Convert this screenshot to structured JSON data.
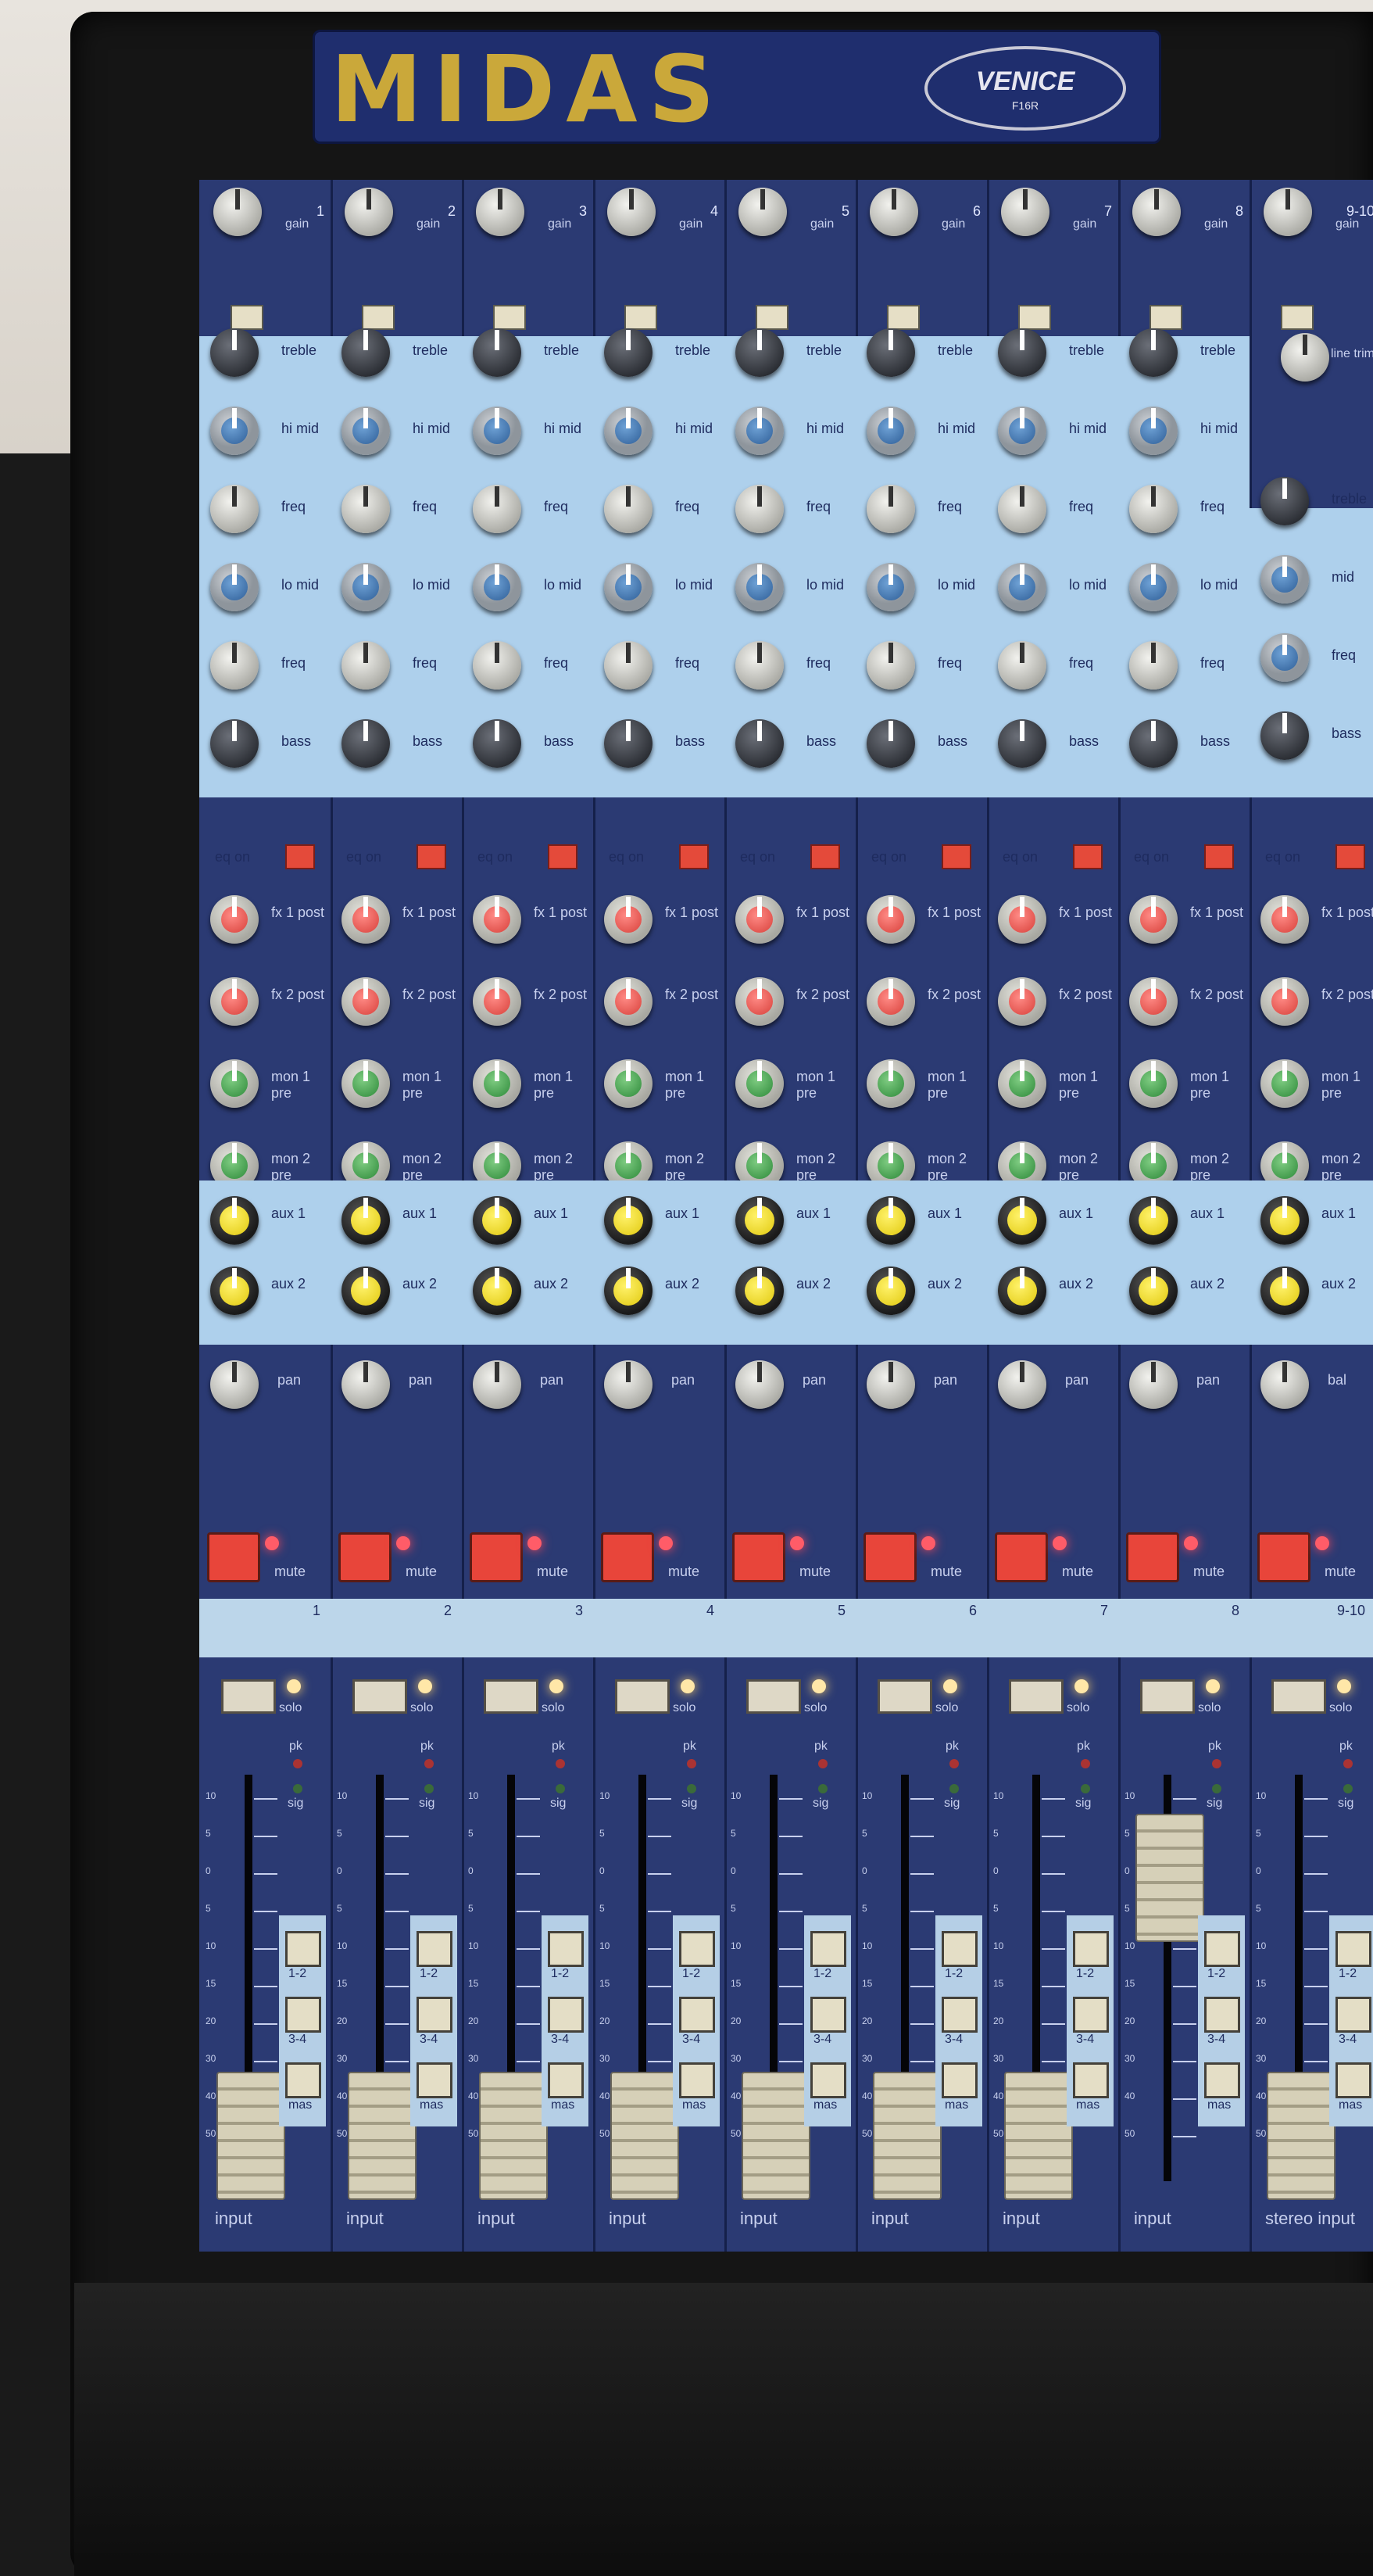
{
  "brand": {
    "logo": "MIDAS",
    "model": "VENICE",
    "model_sub": "F16R"
  },
  "strip_labels": {
    "gain": "gain",
    "line_trim": "line trim",
    "treble": "treble",
    "hi_mid": "hi mid",
    "freq": "freq",
    "lo_mid": "lo mid",
    "mid": "mid",
    "bass": "bass",
    "eq_on": "eq on",
    "fx1": "fx 1 post",
    "fx2": "fx 2 post",
    "mon1": "mon 1 pre",
    "mon2": "mon 2 pre",
    "aux1": "aux 1",
    "aux2": "aux 2",
    "pan": "pan",
    "bal": "bal",
    "mute": "mute",
    "solo": "solo",
    "pk": "pk",
    "sig": "sig",
    "bus12": "1-2",
    "bus34": "3-4",
    "mas": "mas"
  },
  "channels": [
    {
      "number": "1",
      "name_label": "1",
      "footer": "input"
    },
    {
      "number": "2",
      "name_label": "2",
      "footer": "input"
    },
    {
      "number": "3",
      "name_label": "3",
      "footer": "input"
    },
    {
      "number": "4",
      "name_label": "4",
      "footer": "input"
    },
    {
      "number": "5",
      "name_label": "5",
      "footer": "input"
    },
    {
      "number": "6",
      "name_label": "6",
      "footer": "input"
    },
    {
      "number": "7",
      "name_label": "7",
      "footer": "input"
    },
    {
      "number": "8",
      "name_label": "8",
      "footer": "input"
    },
    {
      "number": "9-10",
      "name_label": "9-10",
      "footer": "stereo input"
    }
  ],
  "fader_scale": [
    "10",
    "5",
    "0",
    "5",
    "10",
    "15",
    "20",
    "30",
    "40",
    "50"
  ]
}
